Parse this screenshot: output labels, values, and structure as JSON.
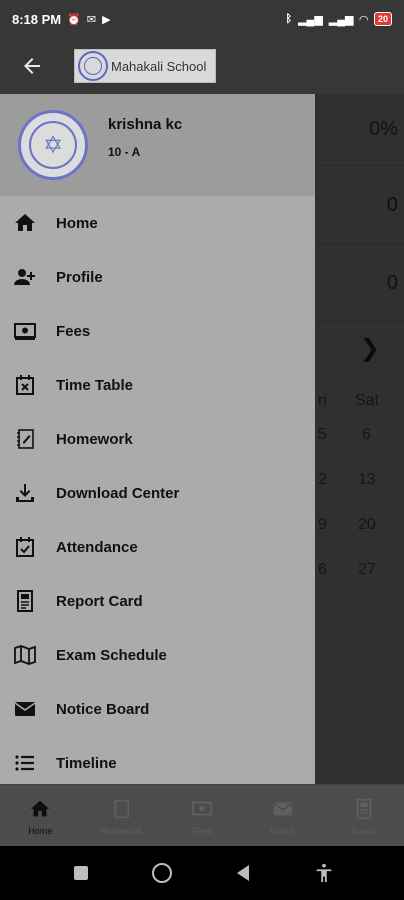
{
  "status_bar": {
    "time": "8:18 PM",
    "battery": "20"
  },
  "app_bar": {
    "school_name": "Mahakali School"
  },
  "background": {
    "stats": [
      "0%",
      "0",
      "0"
    ],
    "calendar_header": [
      "ri",
      "Sat"
    ],
    "calendar_rows": [
      [
        "5",
        "6"
      ],
      [
        "2",
        "13"
      ],
      [
        "9",
        "20"
      ],
      [
        "6",
        "27"
      ]
    ]
  },
  "drawer": {
    "student_name": "krishna kc",
    "class_section": "10 - A",
    "items": [
      {
        "label": "Home",
        "icon": "home-icon"
      },
      {
        "label": "Profile",
        "icon": "add-user-icon"
      },
      {
        "label": "Fees",
        "icon": "money-icon"
      },
      {
        "label": "Time Table",
        "icon": "calendar-x-icon"
      },
      {
        "label": "Homework",
        "icon": "notebook-icon"
      },
      {
        "label": "Download Center",
        "icon": "download-icon"
      },
      {
        "label": "Attendance",
        "icon": "calendar-check-icon"
      },
      {
        "label": "Report Card",
        "icon": "report-icon"
      },
      {
        "label": "Exam Schedule",
        "icon": "map-icon"
      },
      {
        "label": "Notice Board",
        "icon": "envelope-icon"
      },
      {
        "label": "Timeline",
        "icon": "list-icon"
      }
    ]
  },
  "bottom_nav": {
    "items": [
      {
        "label": "Home",
        "active": true
      },
      {
        "label": "Homework",
        "active": false
      },
      {
        "label": "Fees",
        "active": false
      },
      {
        "label": "Notice",
        "active": false
      },
      {
        "label": "Exam",
        "active": false
      }
    ]
  }
}
